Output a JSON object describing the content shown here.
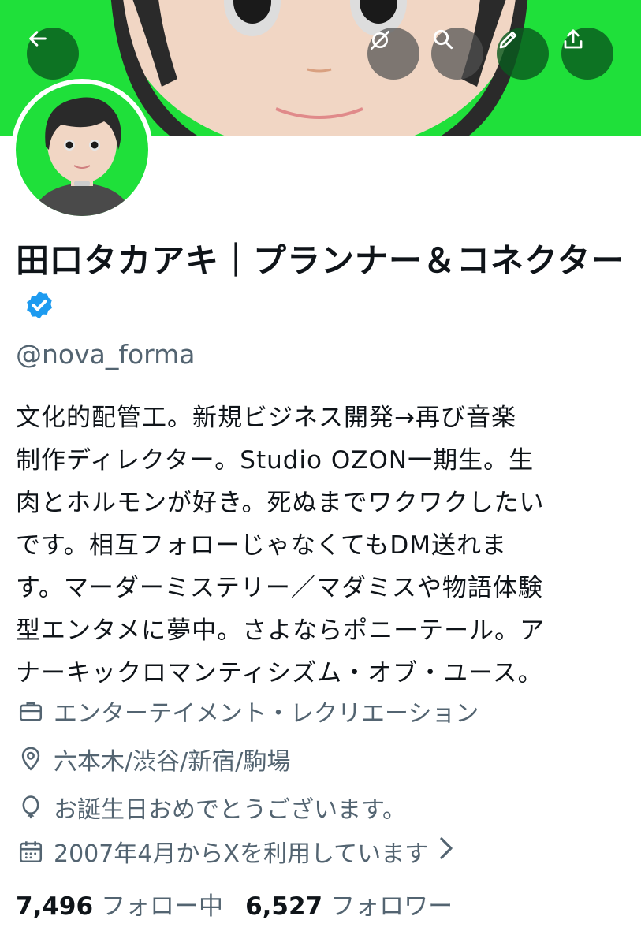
{
  "profile": {
    "display_name": "田口タカアキ｜プランナー＆コネクター",
    "handle": "@nova_forma",
    "bio": "文化的配管工。新規ビジネス開発→再び音楽\n制作ディレクター。Studio OZON一期生。生\n肉とホルモンが好き。死ぬまでワクワクしたい\nです。相互フォローじゃなくてもDM送れま\nす。マーダーミステリー／マダミスや物語体験\n型エンタメに夢中。さよならポニーテール。ア\nナーキックロマンティシズム・オブ・ユース。",
    "category": "エンターテイメント・レクリエーション",
    "location": "六本木/渋谷/新宿/駒場",
    "birthday": "お誕生日おめでとうございます。",
    "joined": "2007年4月からXを利用しています"
  },
  "stats": {
    "following_count": "7,496",
    "following_label": "フォロー中",
    "followers_count": "6,527",
    "followers_label": "フォロワー"
  },
  "icons": {
    "back": "back-arrow-icon",
    "hide": "eye-off-icon",
    "search": "search-icon",
    "edit": "pencil-icon",
    "share": "share-icon",
    "verified": "verified-badge-icon",
    "category": "briefcase-icon",
    "location": "location-pin-icon",
    "birthday": "balloon-icon",
    "joined": "calendar-icon",
    "chevron": "chevron-right-icon"
  },
  "colors": {
    "banner": "#1fe03a",
    "verified": "#1d9bf0",
    "text_primary": "#0f1419",
    "text_secondary": "#536471"
  }
}
